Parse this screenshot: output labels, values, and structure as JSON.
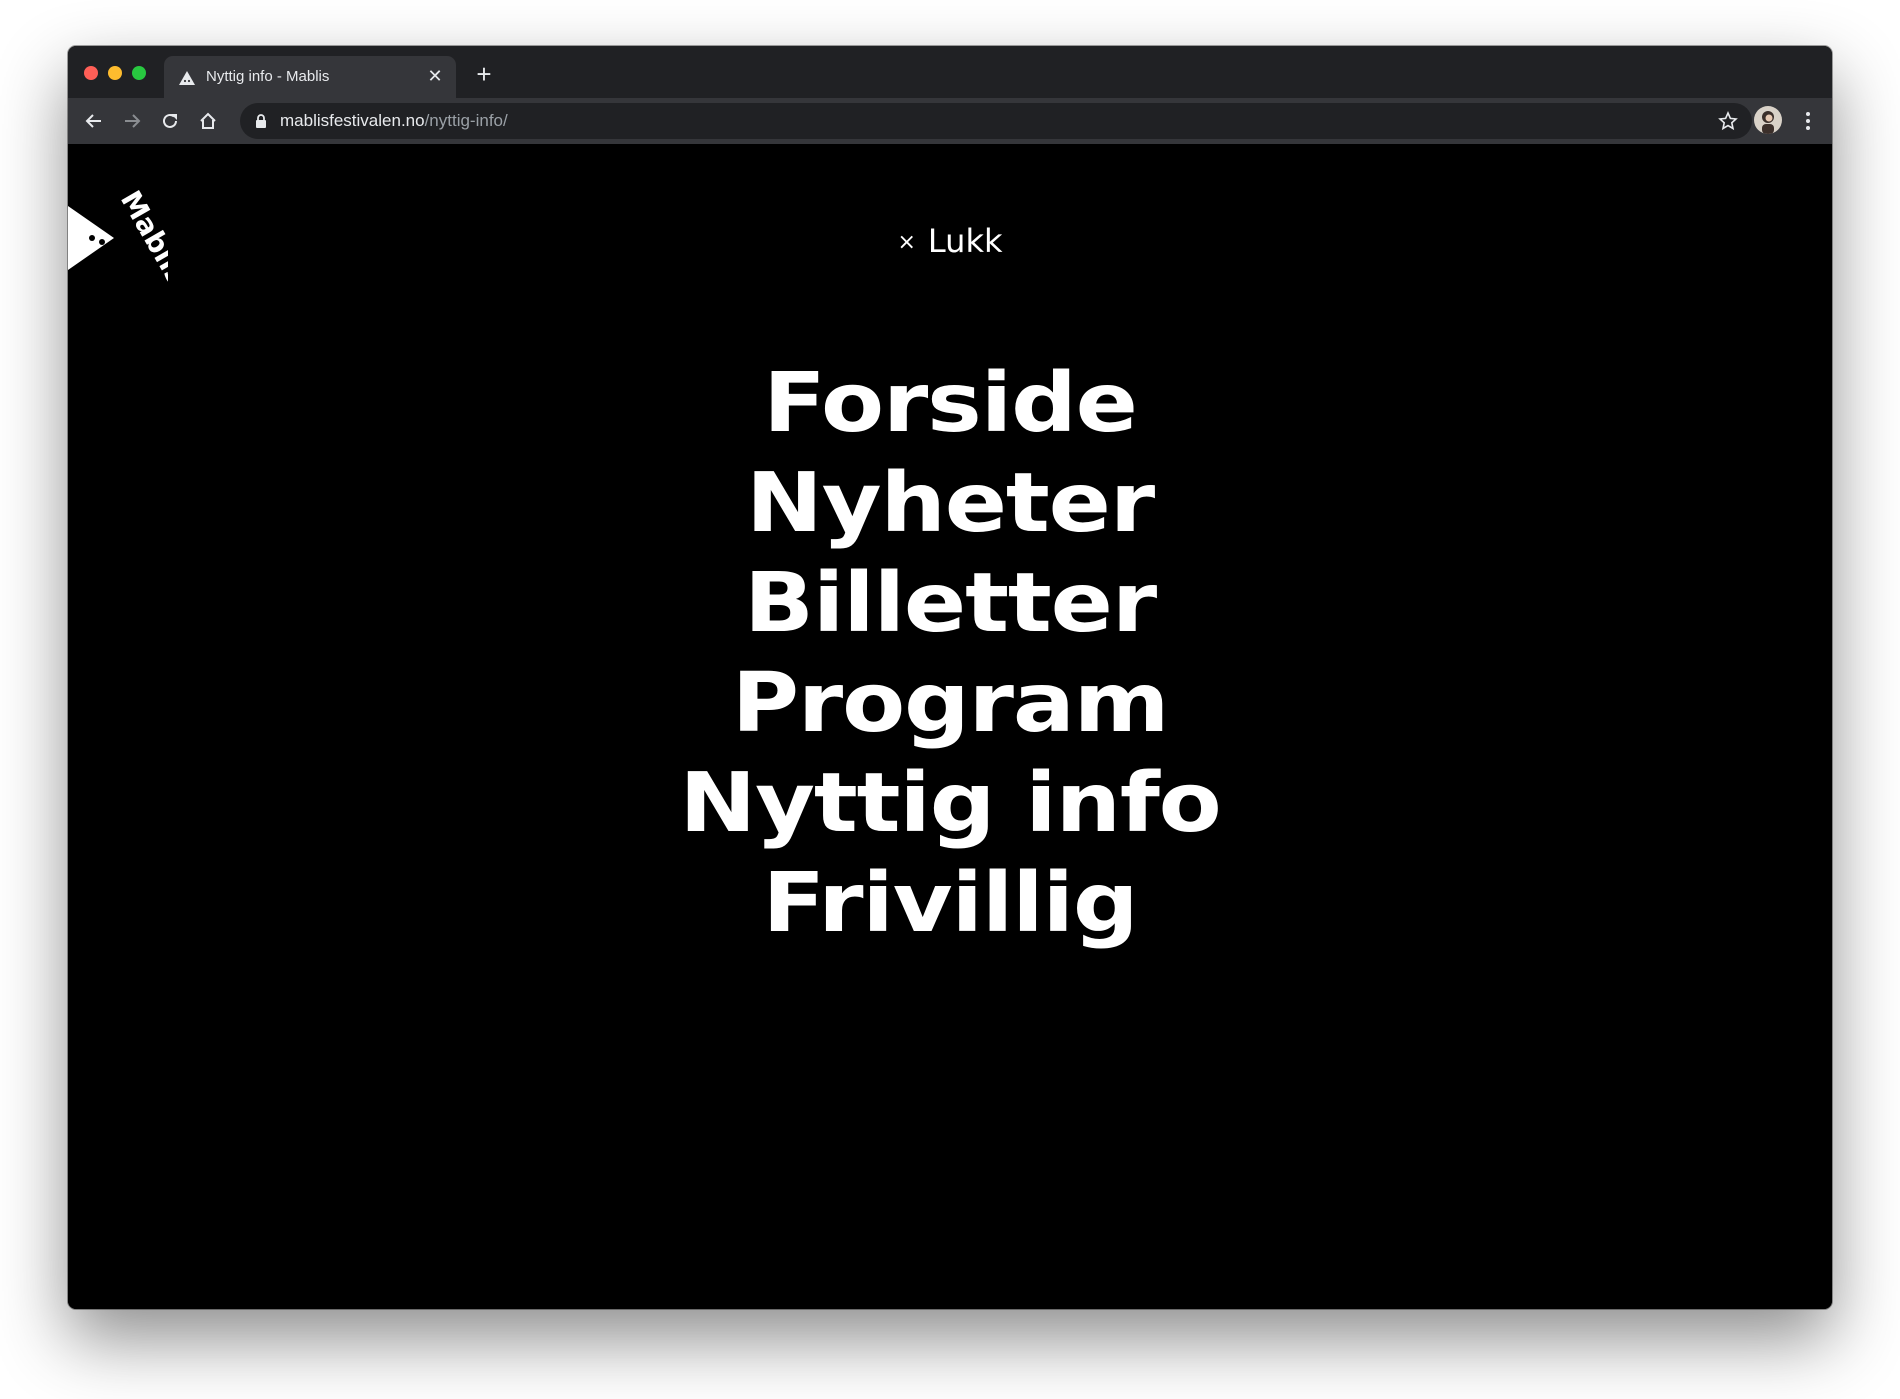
{
  "browser": {
    "tab": {
      "title": "Nyttig info - Mablis",
      "favicon": "mountain-icon",
      "close_label": "✕"
    },
    "new_tab_label": "+",
    "address": {
      "domain": "mablisfestivalen.no",
      "path": "/nyttig-info/"
    }
  },
  "site": {
    "logo_text": "Mablis",
    "close_label": "Lukk",
    "close_icon": "×",
    "nav_items": [
      "Forside",
      "Nyheter",
      "Billetter",
      "Program",
      "Nyttig info",
      "Frivillig"
    ]
  },
  "colors": {
    "background": "#000000",
    "text": "#ffffff",
    "chrome_tabstrip": "#202124",
    "chrome_toolbar": "#35363a"
  }
}
